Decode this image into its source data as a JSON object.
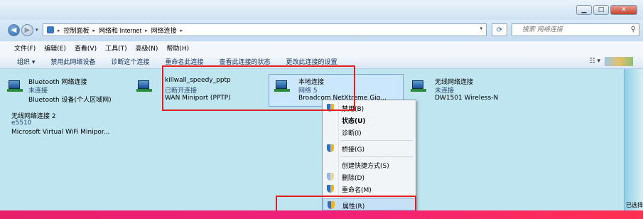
{
  "address": {
    "crumbs": [
      "控制面板",
      "网络和 Internet",
      "网络连接"
    ],
    "search_placeholder": "搜索 网络连接"
  },
  "menu": [
    "文件(F)",
    "编辑(E)",
    "查看(V)",
    "工具(T)",
    "高级(N)",
    "帮助(H)"
  ],
  "toolbar": [
    "组织 ▾",
    "禁用此网络设备",
    "诊断这个连接",
    "重命名此连接",
    "查看此连接的状态",
    "更改此连接的设置"
  ],
  "connections": [
    {
      "name": "Bluetooth 网络连接",
      "status": "未连接",
      "device": "Bluetooth 设备(个人区域网)"
    },
    {
      "name": "killwall_speedy_pptp",
      "status": "已断开连接",
      "device": "WAN Miniport (PPTP)"
    },
    {
      "name": "本地连接",
      "status": "网络 5",
      "device": "Broadcom NetXtreme Gig..."
    },
    {
      "name": "无线网络连接",
      "status": "未连接",
      "device": "DW1501 Wireless-N"
    },
    {
      "name": "无线网络连接 2",
      "status": "e5510",
      "device": "Microsoft Virtual WiFi Minipor..."
    }
  ],
  "context_menu": [
    {
      "label": "禁用(B)",
      "shield": true
    },
    {
      "label": "状态(U)",
      "bold": true
    },
    {
      "label": "诊断(I)"
    },
    {
      "label": "桥接(G)",
      "shield": true
    },
    {
      "label": "创建快捷方式(S)"
    },
    {
      "label": "删除(D)",
      "shield": true,
      "dim": true
    },
    {
      "label": "重命名(M)",
      "shield": true
    },
    {
      "label": "属性(R)",
      "shield": true
    }
  ],
  "right_pane_label": "已选择"
}
